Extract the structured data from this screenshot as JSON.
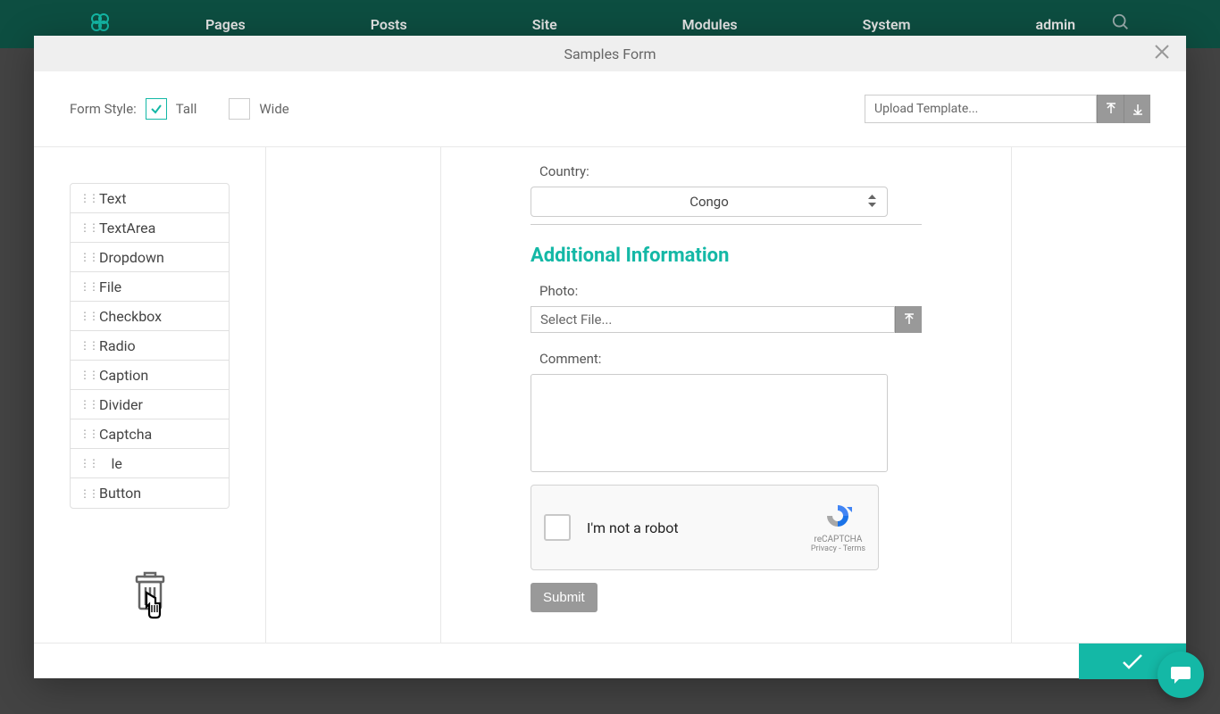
{
  "nav": {
    "items": [
      "Pages",
      "Posts",
      "Site",
      "Modules",
      "System",
      "admin"
    ]
  },
  "modal": {
    "title": "Samples Form",
    "formStyleLabel": "Form Style:",
    "tall": "Tall",
    "wide": "Wide",
    "uploadPlaceholder": "Upload Template..."
  },
  "fields": {
    "items": [
      "Text",
      "TextArea",
      "Dropdown",
      "File",
      "Checkbox",
      "Radio",
      "Caption",
      "Divider",
      "Captcha",
      "le",
      "Button"
    ]
  },
  "preview": {
    "countryLabel": "Country:",
    "countryValue": "Congo",
    "sectionTitle": "Additional Information",
    "photoLabel": "Photo:",
    "selectFile": "Select File...",
    "commentLabel": "Comment:",
    "recaptchaText": "I'm not a robot",
    "recaptchaBrand": "reCAPTCHA",
    "recaptchaLinks": "Privacy - Terms",
    "submit": "Submit"
  }
}
